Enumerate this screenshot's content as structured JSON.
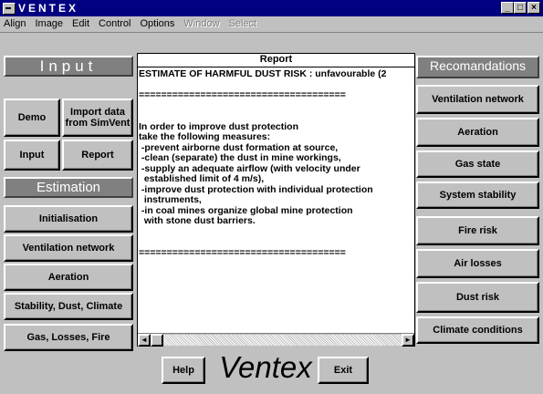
{
  "window": {
    "title": "VENTEX",
    "controls": {
      "minimize": "_",
      "maximize": "□",
      "close": "×"
    }
  },
  "menu": [
    {
      "label": "Align",
      "enabled": true
    },
    {
      "label": "Image",
      "enabled": true
    },
    {
      "label": "Edit",
      "enabled": true
    },
    {
      "label": "Control",
      "enabled": true
    },
    {
      "label": "Options",
      "enabled": true
    },
    {
      "label": "Window",
      "enabled": false
    },
    {
      "label": "Select",
      "enabled": false
    }
  ],
  "left": {
    "input_header": "Input",
    "demo": "Demo",
    "import": "Import data from SimVent",
    "input": "Input",
    "report": "Report",
    "estimation_header": "Estimation",
    "initialisation": "Initialisation",
    "ventilation_network": "Ventilation network",
    "aeration": "Aeration",
    "stability": "Stability, Dust, Climate",
    "gas": "Gas, Losses, Fire"
  },
  "report": {
    "title": "Report",
    "body": "ESTIMATE OF HARMFUL DUST RISK : unfavourable (2\n\n=====================================\n\n\nIn order to improve dust protection\ntake the following measures:\n -prevent airborne dust formation at source,\n -clean (separate) the dust in mine workings,\n -supply an adequate airflow (with velocity under\n  established limit of 4 m/s),\n -improve dust protection with individual protection\n  instruments,\n -in coal mines organize global mine protection\n  with stone dust barriers.\n\n\n=====================================",
    "scroll_left": "◄",
    "scroll_right": "►"
  },
  "right": {
    "header": "Recomandations",
    "items": [
      "Ventilation network",
      "Aeration",
      "Gas state",
      "System stability",
      "Fire risk",
      "Air losses",
      "Dust risk",
      "Climate conditions"
    ]
  },
  "bottom": {
    "help": "Help",
    "logo": "Ventex",
    "exit": "Exit"
  }
}
